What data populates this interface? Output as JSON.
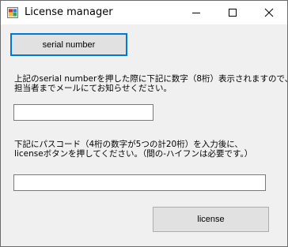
{
  "window": {
    "title": "License manager"
  },
  "serial_button": {
    "label": "serial number"
  },
  "instruction1": {
    "line1": "上記のserial numberを押した際に下記に数字（8桁）表示されますので、",
    "line2": "担当者までメールにてお知らせください。"
  },
  "serial_field": {
    "value": ""
  },
  "instruction2": {
    "line1": "下記にパスコード（4桁の数字が5つの計20桁）を入力後に、",
    "line2": "licenseボタンを押してください。（間の-ハイフンは必要です。）"
  },
  "passcode_field": {
    "value": ""
  },
  "license_button": {
    "label": "license"
  },
  "colors": {
    "focus_border": "#0078d7",
    "client_bg": "#f0f0f0"
  }
}
